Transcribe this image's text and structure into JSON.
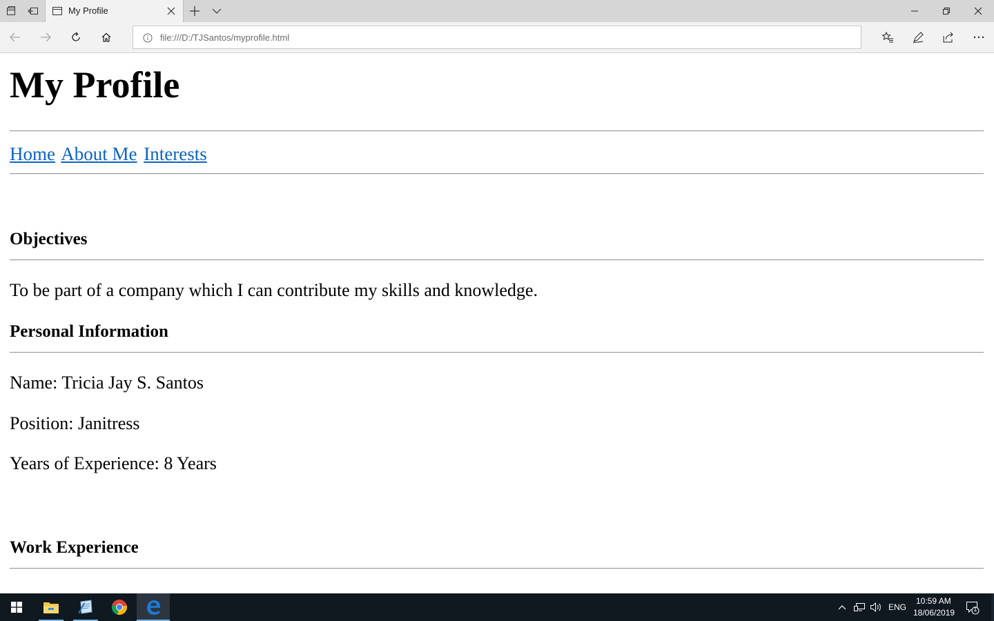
{
  "browser": {
    "tab_title": "My Profile",
    "address": "file:///D:/TJSantos/myprofile.html"
  },
  "page": {
    "title": "My Profile",
    "nav": [
      "Home",
      "About Me",
      "Interests"
    ],
    "objectives_heading": "Objectives",
    "objective_text": "To be part of a company which I can contribute my skills and knowledge.",
    "personal_heading": "Personal Information",
    "name_line": "Name: Tricia Jay S. Santos",
    "position_line": "Position: Janitress",
    "experience_line": "Years of Experience: 8 Years",
    "work_heading": "Work Experience"
  },
  "taskbar": {
    "language": "ENG",
    "time": "10:59 AM",
    "date": "18/06/2019",
    "notification_count": "1"
  },
  "colors": {
    "link": "#0b63c4",
    "taskbar_bg": "#101820",
    "tab_strip_bg": "#d6d6d6",
    "toolbar_bg": "#f2f2f2",
    "edge_blue": "#1e78d4"
  }
}
